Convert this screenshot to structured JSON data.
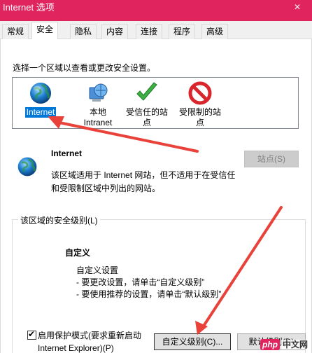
{
  "window": {
    "title": "Internet 选项",
    "close_glyph": "×",
    "accent_color": "#e0245e"
  },
  "tabs": [
    {
      "label": "常规"
    },
    {
      "label": "安全",
      "active": true
    },
    {
      "label": "隐私"
    },
    {
      "label": "内容"
    },
    {
      "label": "连接"
    },
    {
      "label": "程序"
    },
    {
      "label": "高级"
    }
  ],
  "security": {
    "prompt": "选择一个区域以查看或更改安全设置。",
    "zones": [
      {
        "label": "Internet",
        "icon": "globe-icon",
        "selected": true
      },
      {
        "label_line1": "本地",
        "label_line2": "Intranet",
        "icon": "intranet-icon"
      },
      {
        "label_line1": "受信任的站",
        "label_line2": "点",
        "icon": "checkmark-icon"
      },
      {
        "label_line1": "受限制的站",
        "label_line2": "点",
        "icon": "prohibited-icon"
      }
    ],
    "selected_zone_title": "Internet",
    "selected_zone_desc_line1": "该区域适用于 Internet 网站，但不适用于在受信任",
    "selected_zone_desc_line2": "和受限制区域中列出的网站。",
    "sites_button": "站点(S)",
    "level_group_legend": "该区域的安全级别(L)",
    "level_title": "自定义",
    "level_desc": [
      "自定义设置",
      "- 要更改设置，请单击“自定义级别”",
      "- 要使用推荐的设置，请单击“默认级别”"
    ],
    "protected_mode_checked": true,
    "protected_mode_line1": "启用保护模式(要求重新启动",
    "protected_mode_line2": "Internet Explorer)(P)",
    "custom_level_button": "自定义级别(C)...",
    "default_level_button": "默认级别(D)"
  },
  "watermark": {
    "brand": "php",
    "site": "中文网"
  }
}
